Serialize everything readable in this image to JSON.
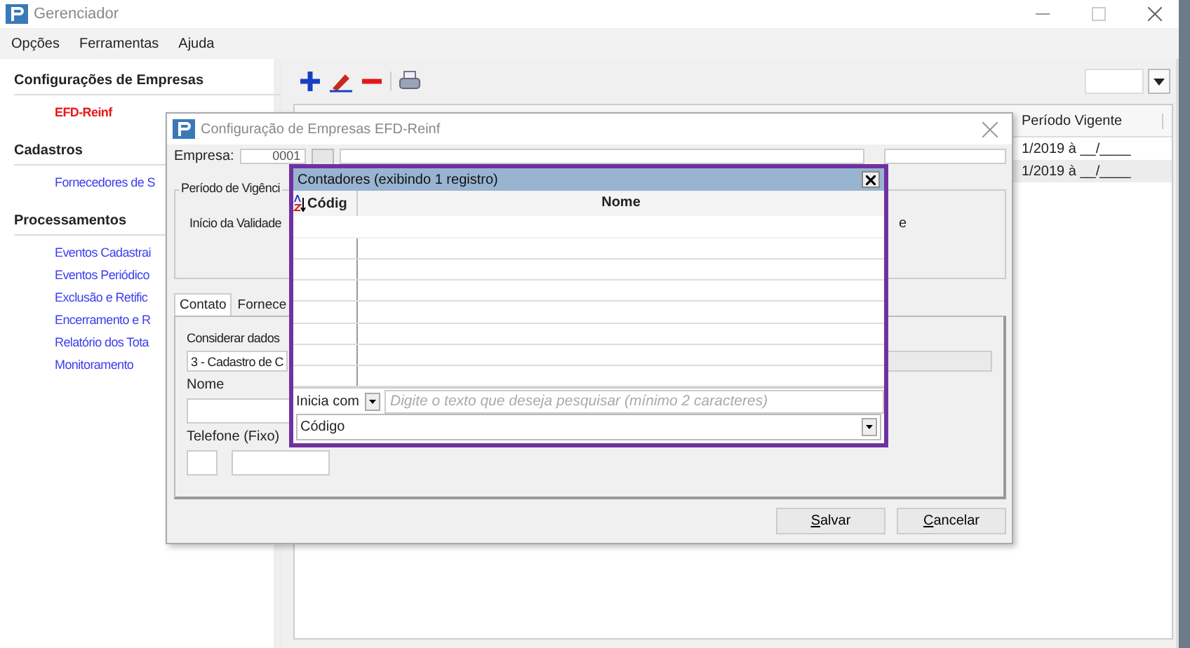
{
  "window": {
    "title": "Gerenciador"
  },
  "menu": [
    "Opções",
    "Ferramentas",
    "Ajuda"
  ],
  "sidebar": [
    {
      "heading": "Configurações de Empresas",
      "items": [
        {
          "label": "EFD-Reinf",
          "selected": true
        }
      ]
    },
    {
      "heading": "Cadastros",
      "items": [
        {
          "label": "Fornecedores de S",
          "selected": false
        }
      ]
    },
    {
      "heading": "Processamentos",
      "items": [
        {
          "label": "Eventos Cadastrai",
          "selected": false
        },
        {
          "label": "Eventos Periódico",
          "selected": false
        },
        {
          "label": "Exclusão e Retific",
          "selected": false
        },
        {
          "label": "Encerramento e R",
          "selected": false
        },
        {
          "label": "Relatório dos Tota",
          "selected": false
        },
        {
          "label": "Monitoramento",
          "selected": false
        }
      ]
    }
  ],
  "table": {
    "columns": [
      "Período Vigente"
    ],
    "rows": [
      [
        "1/2019 à __/____"
      ],
      [
        "1/2019 à __/____"
      ]
    ]
  },
  "dialog": {
    "title": "Configuração de Empresas EFD-Reinf",
    "empresa_label": "Empresa:",
    "empresa_code": "0001",
    "period_group": "Período de Vigênci",
    "start_label": "Início da Validade",
    "side_label": "e",
    "tabs": [
      {
        "label": "Contato",
        "selected": true
      },
      {
        "label": "Fornece",
        "selected": false
      }
    ],
    "consider_label": "Considerar dados",
    "consider_value": "3 - Cadastro de C",
    "name_label": "Nome",
    "phone_label": "Telefone (Fixo)",
    "buttons": [
      "Salvar",
      "Cancelar"
    ]
  },
  "lookup": {
    "title": "Contadores (exibindo 1 registro)",
    "columns": [
      "Códig",
      "Nome"
    ],
    "match_mode": "Inicia com",
    "search_placeholder": "Digite o texto que deseja pesquisar (mínimo 2 caracteres)",
    "search_by": "Código"
  }
}
